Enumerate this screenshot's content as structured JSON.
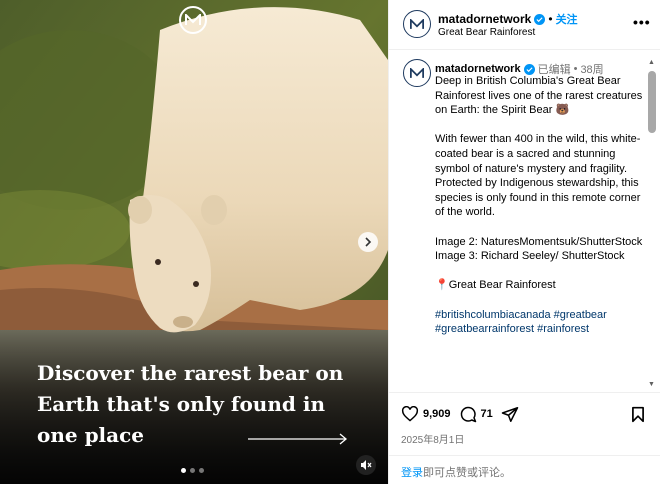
{
  "media": {
    "headline": "Discover the rarest bear on Earth that's only found in one place",
    "carousel_dots": 3,
    "active_dot": 0
  },
  "header": {
    "username": "matadornetwork",
    "separator": "•",
    "follow_label": "关注",
    "location": "Great Bear Rainforest"
  },
  "caption": {
    "username": "matadornetwork",
    "edited": "已编辑",
    "separator": "•",
    "time": "38周",
    "paragraphs": [
      "Deep in British Columbia's Great Bear Rainforest lives one of the rarest creatures on Earth: the Spirit Bear 🐻",
      "With fewer than 400 in the wild, this white-coated bear is a sacred and stunning symbol of nature's mystery and fragility. Protected by Indigenous stewardship, this species is only found in this remote corner of the world.",
      "Image 2: NaturesMomentsuk/ShutterStock\nImage 3: Richard Seeley/ ShutterStock",
      "📍Great Bear Rainforest"
    ],
    "hashtags": "#britishcolumbiacanada #greatbear #greatbearrainforest #rainforest"
  },
  "actions": {
    "likes": "9,909",
    "comments": "71",
    "date": "2025年8月1日"
  },
  "login": {
    "link": "登录",
    "text": "即可点赞或评论。"
  },
  "colors": {
    "accent": "#0095f6",
    "hashtag": "#00376b",
    "muted": "#737373"
  }
}
